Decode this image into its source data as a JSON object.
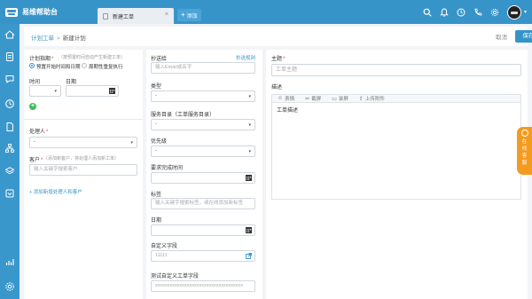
{
  "app": {
    "name": "易维帮助台"
  },
  "tabs": [
    {
      "label": "新建工单",
      "close": "×"
    }
  ],
  "add_tab": {
    "plus": "+",
    "label": "添加"
  },
  "breadcrumb": {
    "parent": "计划工单",
    "sep": ">",
    "current": "新建计划"
  },
  "actions": {
    "cancel": "取消",
    "save": "保存"
  },
  "left": {
    "plan_time_label": "计划指期",
    "plan_time_hint": "（按预置时间自动产生新建工单）",
    "radio_fixed": "预置开始时间和日期",
    "radio_repeat": "周期性重复执行",
    "time_label": "时间",
    "date_label": "日期",
    "time_value": "",
    "date_value": "",
    "handler_label": "处理人",
    "handler_value": "-",
    "customer_label": "客户",
    "customer_hint": "（添加新客户，将处理人添加新工单）",
    "customer_placeholder": "输入关键字搜索客户",
    "add_handler_link": "+ 添加新增处理人和客户"
  },
  "middle": {
    "cc_label": "抄送给",
    "cc_link": "抄送规则",
    "cc_placeholder": "输入Email或名字",
    "type_label": "类型",
    "type_value": "-",
    "catalog_label": "服务目录（工单服务目录）",
    "catalog_value": "-",
    "priority_label": "优先级",
    "priority_value": "-",
    "due_label": "要求完成时间",
    "due_value": "",
    "tags_label": "标签",
    "tags_placeholder": "输入关键字搜索标签，或在线添加新标签",
    "date_label": "日期",
    "date_value": "",
    "custom_label": "自定义字段",
    "custom_placeholder": "11111",
    "test_custom_label": "测试自定义工单字段",
    "test_custom_placeholder": "xxxxxxxxxxxxxxxxxxxxxxxxxxxxxxxxxxxx"
  },
  "right": {
    "subject_label": "主题",
    "subject_placeholder": "工单主题",
    "desc_label": "描述",
    "toolbar": [
      "表情",
      "截屏",
      "录屏",
      "上传附件"
    ],
    "desc_text": "工单描述"
  },
  "float": {
    "chars": [
      "在",
      "线",
      "客",
      "服"
    ]
  },
  "colors": {
    "primary": "#3794c9",
    "accent": "#f39b1f",
    "required": "#e03b3b",
    "success": "#3dbb5a"
  }
}
